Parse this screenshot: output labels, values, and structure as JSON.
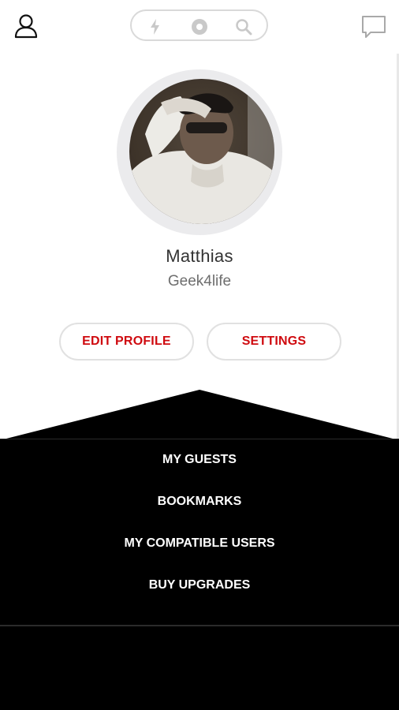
{
  "topbar": {
    "icons": [
      "user-icon",
      "flash-icon",
      "discover-icon",
      "search-icon",
      "chat-icon"
    ]
  },
  "profile": {
    "name": "Matthias",
    "username": "Geek4life"
  },
  "actions": {
    "edit_profile_label": "EDIT PROFILE",
    "settings_label": "SETTINGS"
  },
  "menu": {
    "items": [
      "MY GUESTS",
      "BOOKMARKS",
      "MY COMPATIBLE USERS",
      "BUY UPGRADES"
    ]
  },
  "colors": {
    "accent": "#cf0a0f",
    "panel": "#000000",
    "background": "#ffffff"
  }
}
